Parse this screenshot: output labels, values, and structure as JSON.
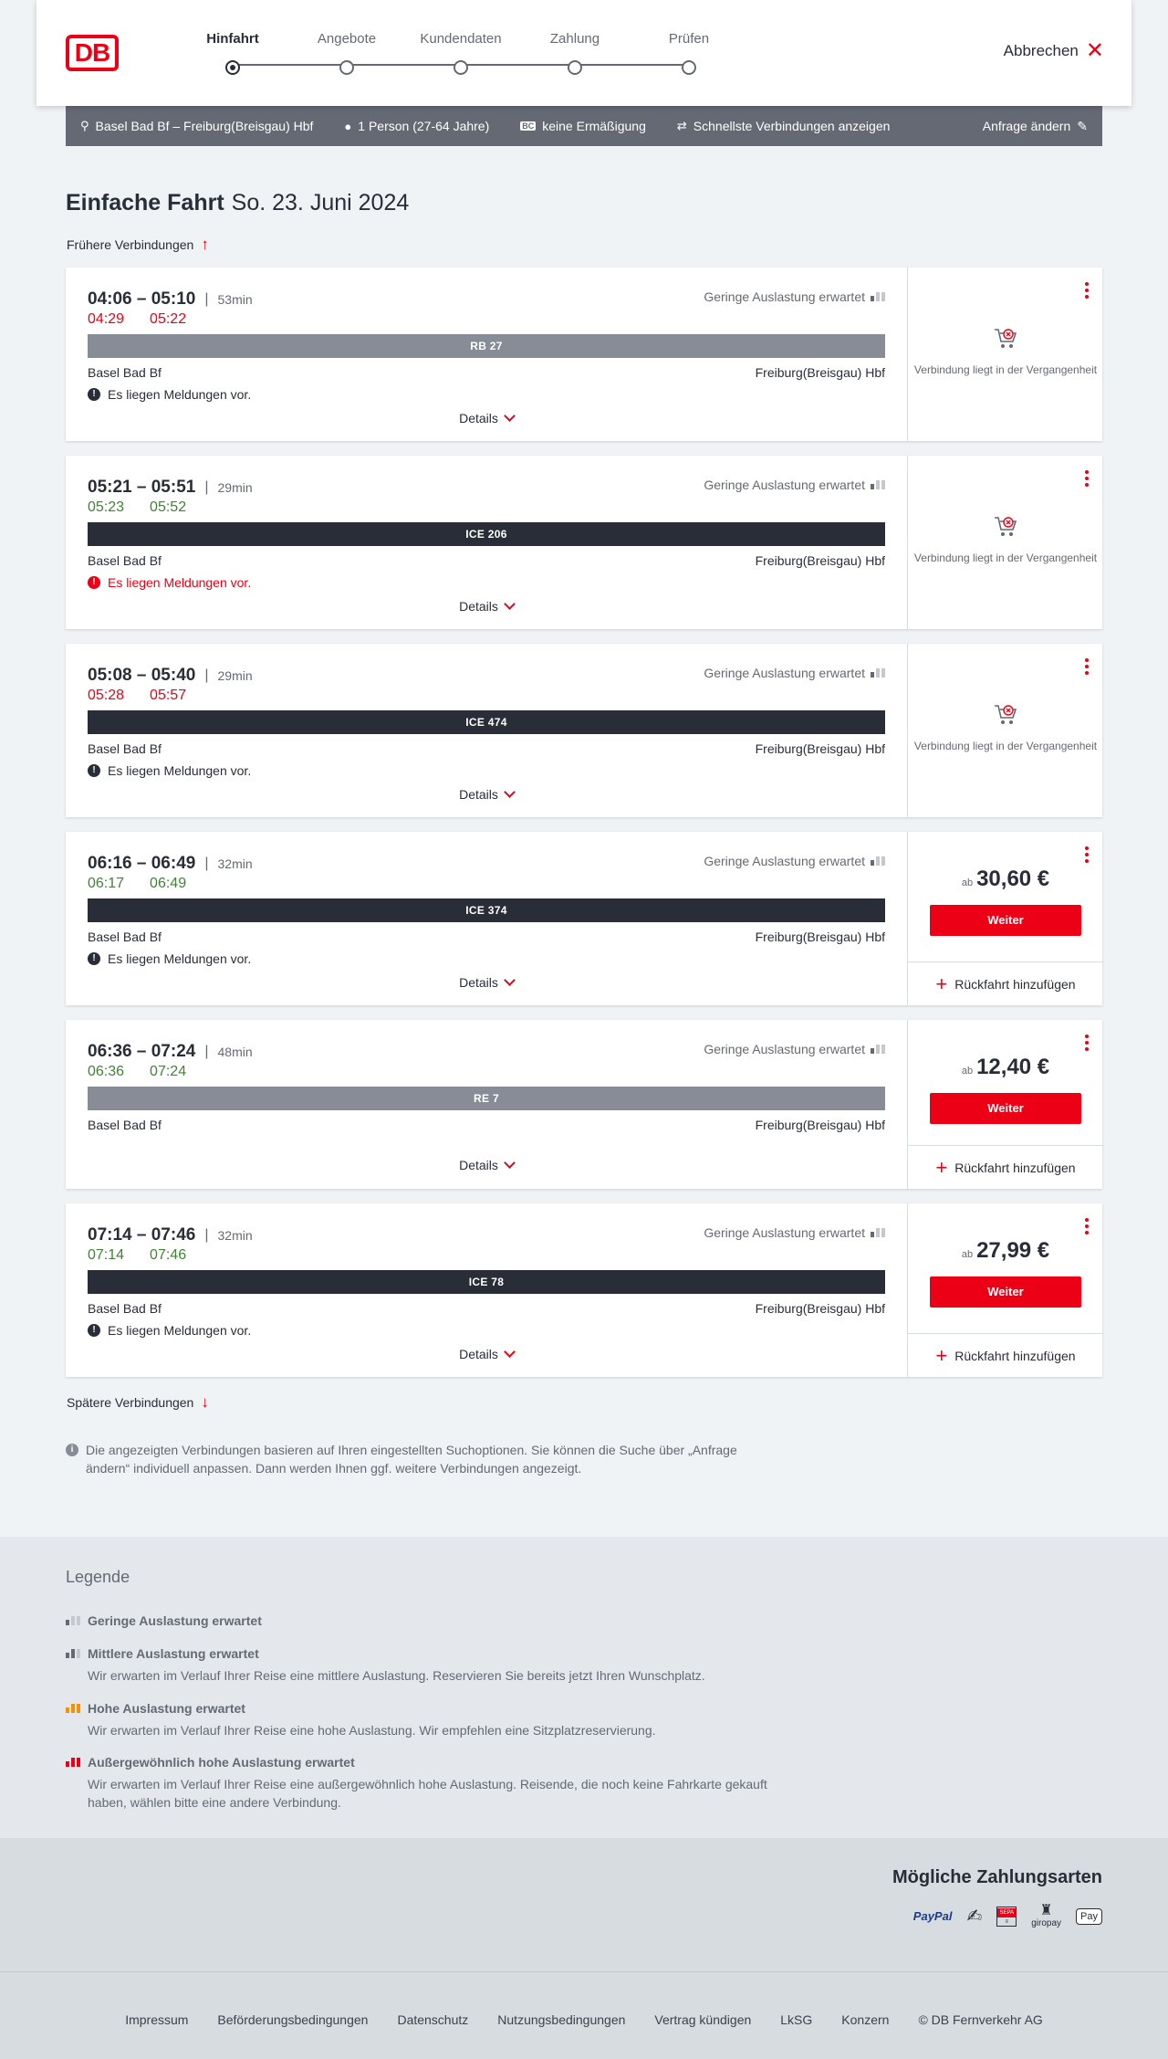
{
  "header": {
    "logo": "DB",
    "steps": [
      "Hinfahrt",
      "Angebote",
      "Kundendaten",
      "Zahlung",
      "Prüfen"
    ],
    "active_step": 0,
    "cancel_label": "Abbrechen"
  },
  "search": {
    "route": "Basel Bad Bf – Freiburg(Breisgau) Hbf",
    "persons": "1 Person (27-64 Jahre)",
    "discount_icon": "BC",
    "discount": "keine Ermäßigung",
    "fastest": "Schnellste Verbindungen anzeigen",
    "change": "Anfrage ändern"
  },
  "title": {
    "type": "Einfache Fahrt",
    "date": "So. 23. Juni 2024"
  },
  "earlier": "Frühere Verbindungen",
  "later": "Spätere Verbindungen",
  "connections": [
    {
      "dep": "04:06",
      "arr": "05:10",
      "duration": "53min",
      "rt_dep": "04:29",
      "rt_arr": "05:22",
      "rt_color": "red",
      "train": "RB 27",
      "bar": "grey",
      "occupancy": "Geringe Auslastung erwartet",
      "from": "Basel Bad Bf",
      "to": "Freiburg(Breisgau) Hbf",
      "message": "Es liegen Meldungen vor.",
      "message_style": "normal",
      "details": "Details",
      "status": "past",
      "past_text": "Verbindung liegt in der Vergangenheit"
    },
    {
      "dep": "05:21",
      "arr": "05:51",
      "duration": "29min",
      "rt_dep": "05:23",
      "rt_arr": "05:52",
      "rt_color": "green",
      "train": "ICE 206",
      "bar": "dark",
      "occupancy": "Geringe Auslastung erwartet",
      "from": "Basel Bad Bf",
      "to": "Freiburg(Breisgau) Hbf",
      "message": "Es liegen Meldungen vor.",
      "message_style": "red",
      "details": "Details",
      "status": "past",
      "past_text": "Verbindung liegt in der Vergangenheit"
    },
    {
      "dep": "05:08",
      "arr": "05:40",
      "duration": "29min",
      "rt_dep": "05:28",
      "rt_arr": "05:57",
      "rt_color": "red",
      "train": "ICE 474",
      "bar": "dark",
      "occupancy": "Geringe Auslastung erwartet",
      "from": "Basel Bad Bf",
      "to": "Freiburg(Breisgau) Hbf",
      "message": "Es liegen Meldungen vor.",
      "message_style": "normal",
      "details": "Details",
      "status": "past",
      "past_text": "Verbindung liegt in der Vergangenheit"
    },
    {
      "dep": "06:16",
      "arr": "06:49",
      "duration": "32min",
      "rt_dep": "06:17",
      "rt_arr": "06:49",
      "rt_color": "green",
      "train": "ICE 374",
      "bar": "dark",
      "occupancy": "Geringe Auslastung erwartet",
      "from": "Basel Bad Bf",
      "to": "Freiburg(Breisgau) Hbf",
      "message": "Es liegen Meldungen vor.",
      "message_style": "normal",
      "details": "Details",
      "status": "price",
      "price_prefix": "ab",
      "price": "30,60 €",
      "button": "Weiter",
      "return_label": "Rückfahrt hinzufügen"
    },
    {
      "dep": "06:36",
      "arr": "07:24",
      "duration": "48min",
      "rt_dep": "06:36",
      "rt_arr": "07:24",
      "rt_color": "green",
      "train": "RE 7",
      "bar": "grey",
      "occupancy": "Geringe Auslastung erwartet",
      "from": "Basel Bad Bf",
      "to": "Freiburg(Breisgau) Hbf",
      "message": "",
      "message_style": "none",
      "details": "Details",
      "status": "price",
      "price_prefix": "ab",
      "price": "12,40 €",
      "button": "Weiter",
      "return_label": "Rückfahrt hinzufügen"
    },
    {
      "dep": "07:14",
      "arr": "07:46",
      "duration": "32min",
      "rt_dep": "07:14",
      "rt_arr": "07:46",
      "rt_color": "green",
      "train": "ICE 78",
      "bar": "dark",
      "occupancy": "Geringe Auslastung erwartet",
      "from": "Basel Bad Bf",
      "to": "Freiburg(Breisgau) Hbf",
      "message": "Es liegen Meldungen vor.",
      "message_style": "normal",
      "details": "Details",
      "status": "price",
      "price_prefix": "ab",
      "price": "27,99 €",
      "button": "Weiter",
      "return_label": "Rückfahrt hinzufügen"
    }
  ],
  "info_text": "Die angezeigten Verbindungen basieren auf Ihren eingestellten Suchoptionen. Sie können die Suche über „Anfrage ändern“ individuell anpassen. Dann werden Ihnen ggf. weitere Verbindungen angezeigt.",
  "legend": {
    "title": "Legende",
    "items": [
      {
        "title": "Geringe Auslastung erwartet",
        "text": "",
        "level": 1,
        "color": "#646973"
      },
      {
        "title": "Mittlere Auslastung erwartet",
        "text": "Wir erwarten im Verlauf Ihrer Reise eine mittlere Auslastung. Reservieren Sie bereits jetzt Ihren Wunschplatz.",
        "level": 2,
        "color": "#646973"
      },
      {
        "title": "Hohe Auslastung erwartet",
        "text": "Wir erwarten im Verlauf Ihrer Reise eine hohe Auslastung. Wir empfehlen eine Sitzplatzreservierung.",
        "level": 3,
        "color": "#f39200"
      },
      {
        "title": "Außergewöhnlich hohe Auslastung erwartet",
        "text": "Wir erwarten im Verlauf Ihrer Reise eine außergewöhnlich hohe Auslastung. Reisende, die noch keine Fahrkarte gekauft haben, wählen bitte eine andere Verbindung.",
        "level": 4,
        "color": "#ec0016"
      }
    ]
  },
  "payment": {
    "title": "Mögliche Zahlungsarten",
    "methods": [
      {
        "label": "PayPal",
        "icon": "paypal-icon"
      },
      {
        "label": "",
        "icon": "credit-card-icon"
      },
      {
        "label": "SEPA",
        "icon": "sepa-icon"
      },
      {
        "label": "giropay",
        "icon": "giropay-icon"
      },
      {
        "label": "Pay",
        "icon": "apple-pay-icon"
      }
    ]
  },
  "footer": {
    "links": [
      "Impressum",
      "Beförderungsbedingungen",
      "Datenschutz",
      "Nutzungsbedingungen",
      "Vertrag kündigen",
      "LkSG",
      "Konzern",
      "© DB Fernverkehr AG"
    ]
  },
  "colors": {
    "brand": "#ec0016",
    "delay": "#ec0016",
    "ontime": "#408335",
    "bar_dark": "#282d37",
    "bar_grey": "#878c96"
  }
}
